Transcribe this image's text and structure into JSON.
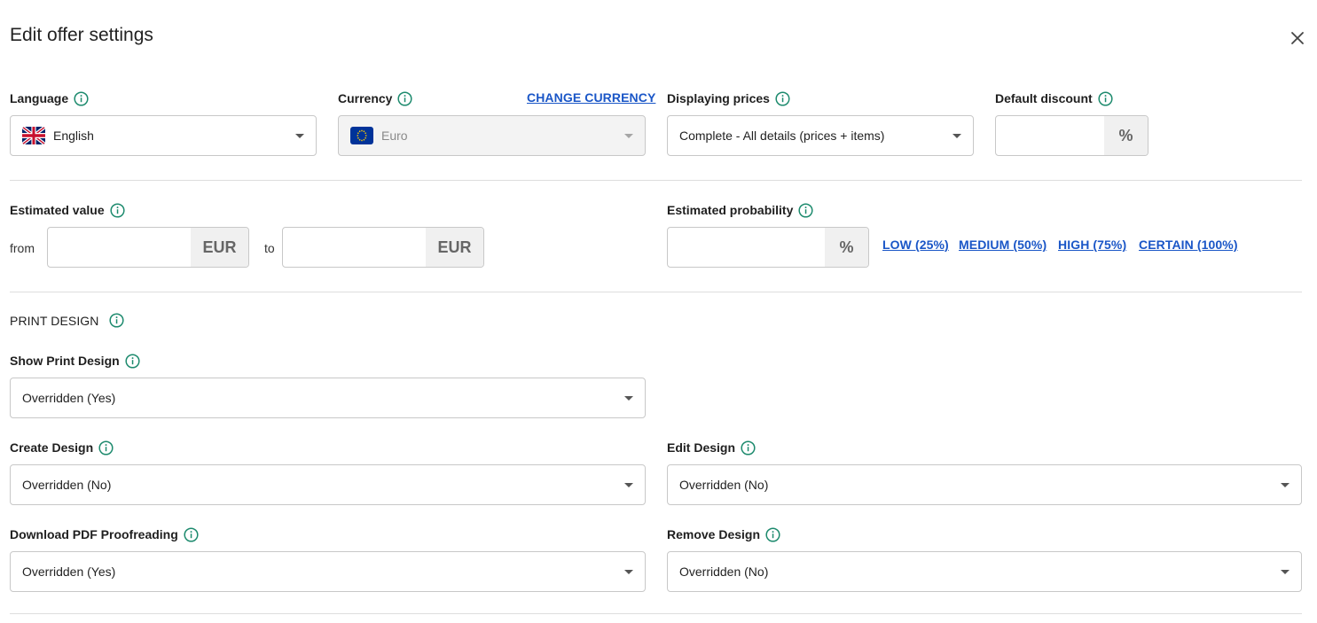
{
  "dialog": {
    "title": "Edit offer settings"
  },
  "colors": {
    "accent_link": "#1a56c7",
    "info_icon": "#1c8a6d"
  },
  "language": {
    "label": "Language",
    "value": "English",
    "icon": "uk-flag-icon"
  },
  "currency": {
    "label": "Currency",
    "value": "Euro",
    "change_link": "CHANGE CURRENCY",
    "icon": "eu-flag-icon"
  },
  "displaying_prices": {
    "label": "Displaying prices",
    "value": "Complete - All details (prices + items)"
  },
  "default_discount": {
    "label": "Default discount",
    "value": "",
    "unit": "%"
  },
  "estimated_value": {
    "label": "Estimated value",
    "from_label": "from",
    "to_label": "to",
    "from_value": "",
    "to_value": "",
    "currency_unit": "EUR"
  },
  "estimated_probability": {
    "label": "Estimated probability",
    "value": "",
    "unit": "%",
    "presets": [
      "LOW (25%)",
      "MEDIUM (50%)",
      "HIGH (75%)",
      "CERTAIN (100%)"
    ]
  },
  "print_design": {
    "section_title": "PRINT DESIGN",
    "show": {
      "label": "Show Print Design",
      "value": "Overridden (Yes)"
    },
    "create": {
      "label": "Create Design",
      "value": "Overridden (No)"
    },
    "edit": {
      "label": "Edit Design",
      "value": "Overridden (No)"
    },
    "download_pdf": {
      "label": "Download PDF Proofreading",
      "value": "Overridden (Yes)"
    },
    "remove": {
      "label": "Remove Design",
      "value": "Overridden (No)"
    }
  }
}
